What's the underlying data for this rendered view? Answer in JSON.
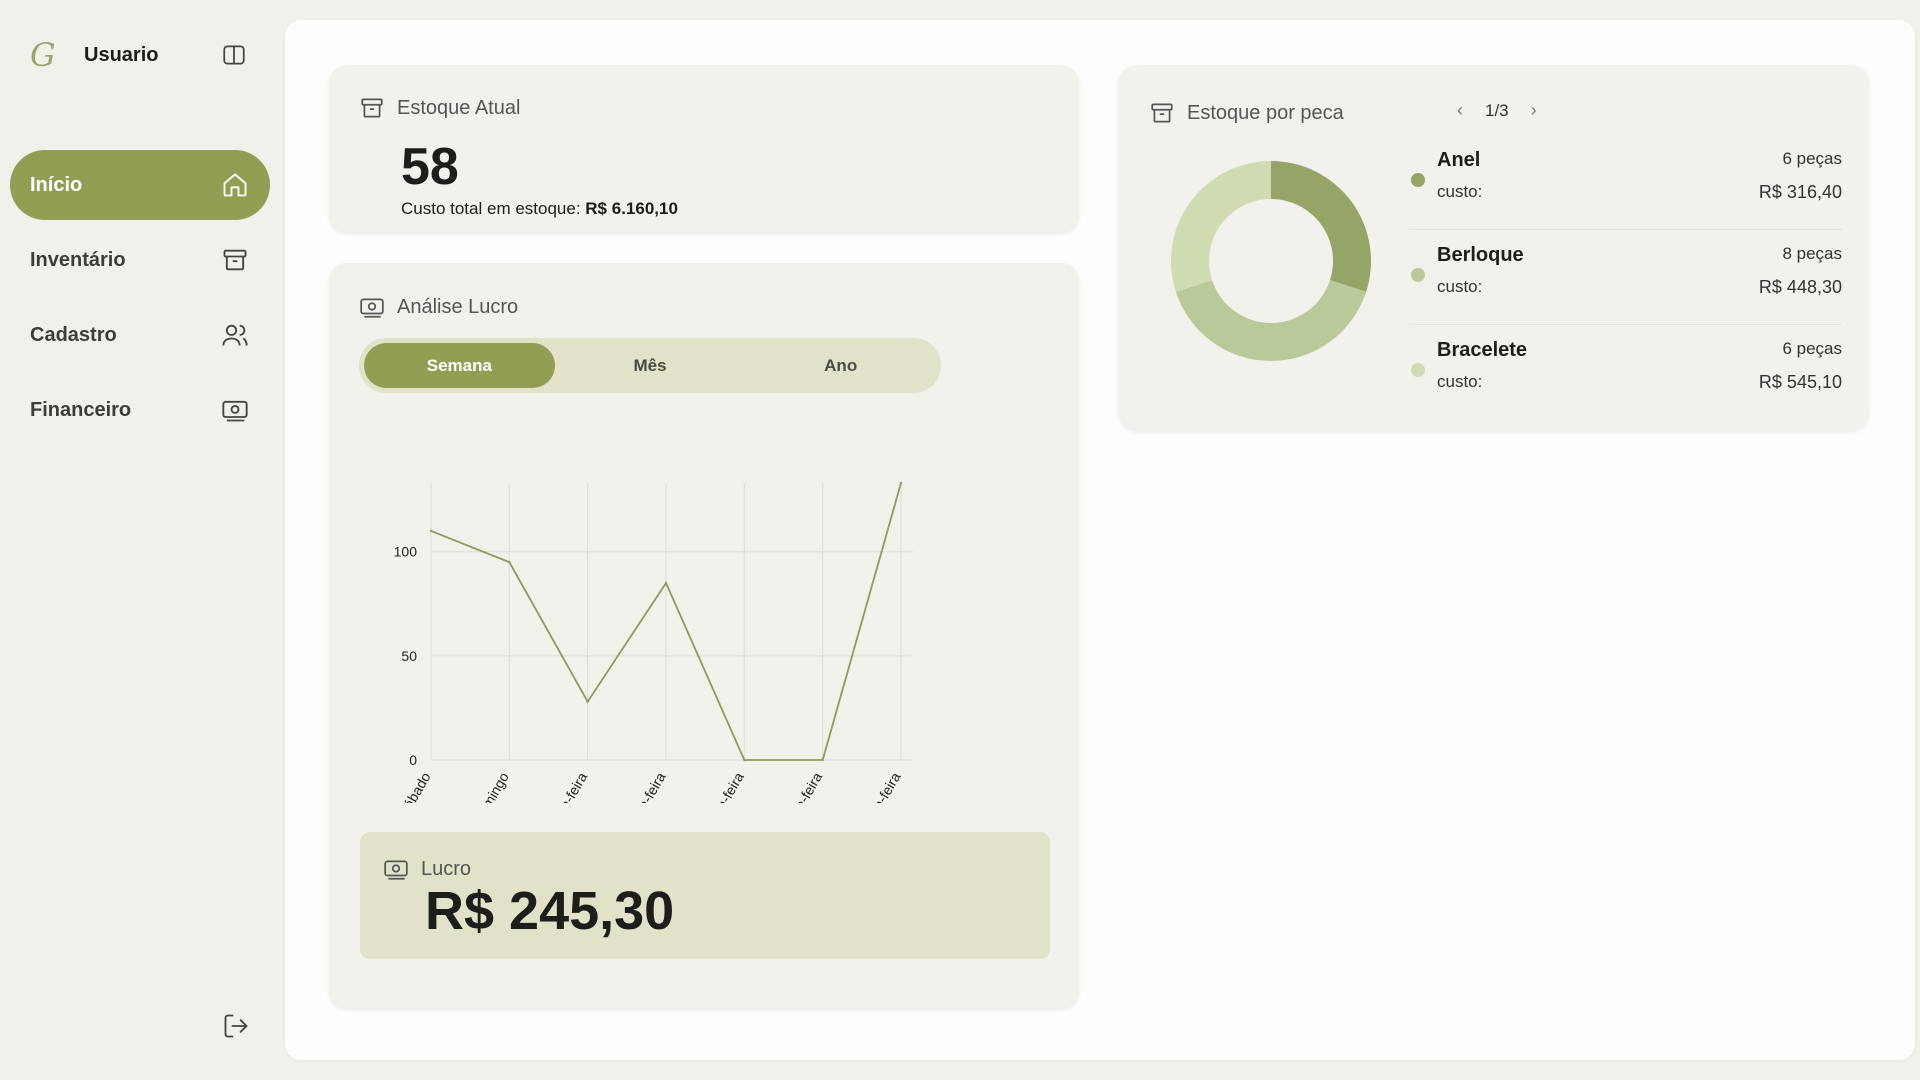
{
  "sidebar": {
    "logo": "G",
    "user": "Usuario",
    "items": [
      {
        "label": "Início",
        "icon": "home-icon",
        "active": true
      },
      {
        "label": "Inventário",
        "icon": "archive-icon",
        "active": false
      },
      {
        "label": "Cadastro",
        "icon": "users-icon",
        "active": false
      },
      {
        "label": "Financeiro",
        "icon": "banknote-icon",
        "active": false
      }
    ]
  },
  "stock": {
    "title": "Estoque Atual",
    "value": "58",
    "cost_label": "Custo total em estoque:",
    "cost_value": "R$ 6.160,10"
  },
  "profit": {
    "title": "Análise Lucro",
    "tabs": [
      {
        "label": "Semana",
        "active": true
      },
      {
        "label": "Mês",
        "active": false
      },
      {
        "label": "Ano",
        "active": false
      }
    ],
    "total_label": "Lucro",
    "total_value": "R$ 245,30"
  },
  "chart_data": {
    "type": "line",
    "categories": [
      "Sábado",
      "Domingo",
      "Segunda-feira",
      "Terça-feira",
      "Quarta-feira",
      "Quinta-feira",
      "Sexta-feira"
    ],
    "series": [
      {
        "values": [
          110,
          95,
          28,
          85,
          0,
          0,
          133
        ]
      }
    ],
    "yticks": [
      0,
      50,
      100
    ],
    "ylim": [
      0,
      133
    ],
    "grid": true,
    "color": "#8f9b5a"
  },
  "pieces": {
    "title": "Estoque por peca",
    "page": "1/3",
    "items": [
      {
        "name": "Anel",
        "qty": "6 peças",
        "cost_label": "custo:",
        "cost": "R$ 316,40",
        "color": "#96a468",
        "share": 6
      },
      {
        "name": "Berloque",
        "qty": "8 peças",
        "cost_label": "custo:",
        "cost": "R$ 448,30",
        "color": "#bac99a",
        "share": 8
      },
      {
        "name": "Bracelete",
        "qty": "6 peças",
        "cost_label": "custo:",
        "cost": "R$ 545,10",
        "color": "#d1dbb2",
        "share": 6
      }
    ]
  }
}
